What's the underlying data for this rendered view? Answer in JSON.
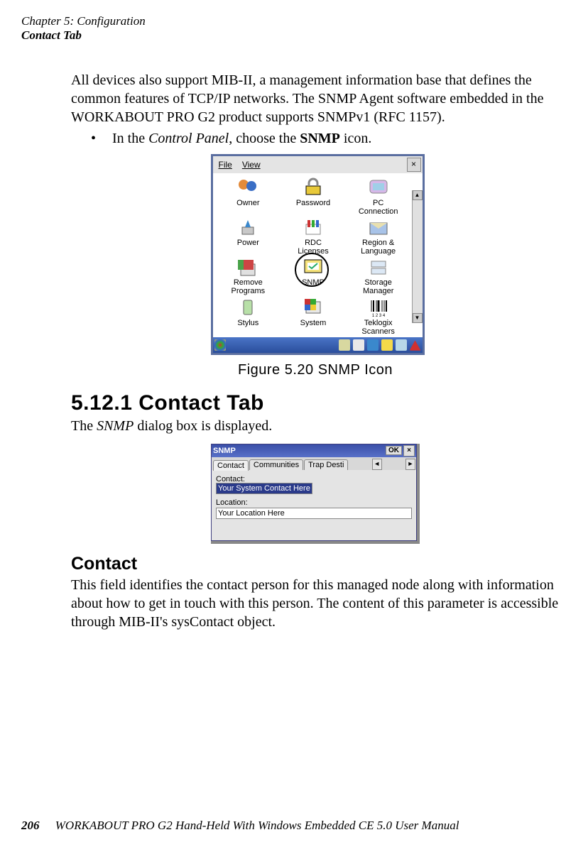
{
  "header": {
    "chapter": "Chapter 5: Configuration",
    "section": "Contact Tab"
  },
  "para1": "All devices also support MIB-II, a management information base that defines the common features of TCP/IP networks. The SNMP Agent software embedded in the WORKABOUT PRO G2 product supports SNMPv1 (RFC 1157).",
  "bullet": {
    "pre": "In the ",
    "italic": "Control Panel",
    "mid": ", choose the ",
    "bold": "SNMP",
    "post": " icon."
  },
  "figure1": {
    "menu_file": "File",
    "menu_view": "View",
    "close_x": "×",
    "icons": [
      {
        "label": "Owner"
      },
      {
        "label": "Password"
      },
      {
        "label": "PC\nConnection"
      },
      {
        "label": "Power"
      },
      {
        "label": "RDC\nLicenses"
      },
      {
        "label": "Region &\nLanguage"
      },
      {
        "label": "Remove\nPrograms"
      },
      {
        "label": "SNMP"
      },
      {
        "label": "Storage\nManager"
      },
      {
        "label": "Stylus"
      },
      {
        "label": "System"
      },
      {
        "label": "Teklogix\nScanners"
      }
    ],
    "caption": "Figure 5.20 SNMP Icon"
  },
  "heading": "5.12.1  Contact Tab",
  "para2_pre": "The ",
  "para2_italic": "SNMP",
  "para2_post": " dialog box is displayed.",
  "dialog": {
    "title": "SNMP",
    "ok": "OK",
    "x": "×",
    "tab_contact": "Contact",
    "tab_communities": "Communities",
    "tab_trap": "Trap Desti",
    "label_contact": "Contact:",
    "value_contact": "Your System Contact Here",
    "label_location": "Location:",
    "value_location": "Your Location Here"
  },
  "subheading": "Contact",
  "para3": "This field identifies the contact person for this managed node along with information about how to get in touch with this person. The content of this parameter is accessible through MIB-II's sysContact object.",
  "footer": {
    "pagenum": "206",
    "text": "WORKABOUT PRO G2 Hand-Held With Windows Embedded CE 5.0 User Manual"
  }
}
